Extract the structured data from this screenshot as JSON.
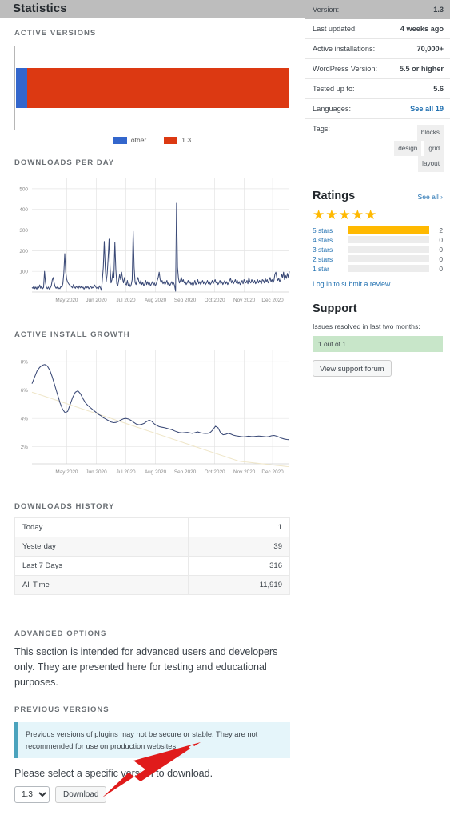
{
  "header": {
    "title": "Statistics"
  },
  "sections": {
    "active_versions": "Active Versions",
    "downloads_per_day": "Downloads Per Day",
    "active_install_growth": "Active Install Growth",
    "downloads_history": "Downloads History",
    "advanced_options": "Advanced Options",
    "previous_versions": "Previous Versions"
  },
  "meta": {
    "rows": [
      {
        "key": "Version:",
        "value": "1.3",
        "link": false
      },
      {
        "key": "Last updated:",
        "value": "4 weeks ago",
        "link": false
      },
      {
        "key": "Active installations:",
        "value": "70,000+",
        "link": false
      },
      {
        "key": "WordPress Version:",
        "value": "5.5 or higher",
        "link": false
      },
      {
        "key": "Tested up to:",
        "value": "5.6",
        "link": false
      },
      {
        "key": "Languages:",
        "value": "See all 19",
        "link": true
      }
    ],
    "tags_key": "Tags:",
    "tags": [
      "blocks",
      "design",
      "grid",
      "layout"
    ]
  },
  "ratings": {
    "title": "Ratings",
    "see_all": "See all  ›",
    "stars_filled": 5,
    "star_glyph": "★",
    "bars": [
      {
        "label": "5 stars",
        "count": 2,
        "percent": 100
      },
      {
        "label": "4 stars",
        "count": 0,
        "percent": 0
      },
      {
        "label": "3 stars",
        "count": 0,
        "percent": 0
      },
      {
        "label": "2 stars",
        "count": 0,
        "percent": 0
      },
      {
        "label": "1 star",
        "count": 0,
        "percent": 0
      }
    ],
    "review_link": "Log in to submit a review."
  },
  "support": {
    "title": "Support",
    "note": "Issues resolved in last two months:",
    "resolved": "1 out of 1",
    "button": "View support forum"
  },
  "downloads_history": {
    "rows": [
      {
        "label": "Today",
        "value": "1"
      },
      {
        "label": "Yesterday",
        "value": "39"
      },
      {
        "label": "Last 7 Days",
        "value": "316"
      },
      {
        "label": "All Time",
        "value": "11,919"
      }
    ]
  },
  "advanced": {
    "paragraph": "This section is intended for advanced users and developers only. They are presented here for testing and educational purposes.",
    "notice": "Previous versions of plugins may not be secure or stable. They are not recommended for use on production websites.",
    "select_prompt": "Please select a specific version to download.",
    "selected_version": "1.3",
    "version_options": [
      "1.3"
    ],
    "download_button": "Download"
  },
  "colors": {
    "other": "#3366cc",
    "version_1_3": "#dc3912",
    "line": "#3b4a77",
    "trend": "#efe6c8",
    "rating_bar": "#ffb900",
    "link": "#2271b1",
    "arrow": "#e01b1b"
  },
  "chart_data": [
    {
      "type": "bar",
      "name": "active_versions",
      "title": "Active Versions",
      "orientation": "horizontal",
      "stacked": true,
      "categories": [
        "other",
        "1.3"
      ],
      "values": [
        4,
        96
      ],
      "colors": [
        "#3366cc",
        "#dc3912"
      ],
      "legend": [
        "other",
        "1.3"
      ],
      "legend_position": "bottom"
    },
    {
      "type": "line",
      "name": "downloads_per_day",
      "title": "Downloads Per Day",
      "xlabel": "",
      "ylabel": "",
      "ylim": [
        0,
        550
      ],
      "yticks": [
        100,
        200,
        300,
        400,
        500
      ],
      "grid": true,
      "xticks": [
        "May 2020",
        "Jun 2020",
        "Jul 2020",
        "Aug 2020",
        "Sep 2020",
        "Oct 2020",
        "Nov 2020",
        "Dec 2020"
      ],
      "xtick_positions": [
        0.135,
        0.25,
        0.365,
        0.48,
        0.595,
        0.71,
        0.825,
        0.935
      ],
      "values": [
        22,
        18,
        30,
        16,
        24,
        14,
        26,
        20,
        34,
        18,
        28,
        16,
        22,
        100,
        46,
        22,
        16,
        24,
        14,
        20,
        30,
        58,
        70,
        44,
        26,
        18,
        24,
        14,
        20,
        16,
        28,
        22,
        40,
        90,
        186,
        96,
        62,
        48,
        40,
        34,
        30,
        26,
        20,
        36,
        24,
        18,
        28,
        22,
        16,
        30,
        20,
        26,
        18,
        24,
        14,
        22,
        30,
        20,
        26,
        16,
        22,
        28,
        18,
        24,
        20,
        34,
        26,
        18,
        22,
        16,
        30,
        20,
        8,
        60,
        120,
        245,
        120,
        50,
        86,
        160,
        256,
        120,
        44,
        60,
        100,
        70,
        240,
        110,
        40,
        30,
        56,
        86,
        60,
        96,
        64,
        44,
        70,
        40,
        34,
        56,
        30,
        40,
        26,
        36,
        60,
        294,
        120,
        46,
        36,
        56,
        70,
        50,
        40,
        56,
        36,
        46,
        30,
        40,
        56,
        36,
        50,
        36,
        44,
        30,
        40,
        50,
        34,
        44,
        30,
        40,
        56,
        70,
        96,
        60,
        44,
        56,
        40,
        50,
        36,
        44,
        56,
        36,
        46,
        30,
        40,
        50,
        36,
        44,
        30,
        4,
        430,
        120,
        66,
        44,
        56,
        70,
        50,
        60,
        44,
        50,
        36,
        44,
        56,
        40,
        50,
        36,
        44,
        30,
        40,
        56,
        36,
        44,
        60,
        40,
        50,
        36,
        46,
        56,
        40,
        50,
        36,
        44,
        56,
        40,
        50,
        36,
        44,
        56,
        40,
        50,
        60,
        44,
        50,
        36,
        44,
        56,
        40,
        50,
        36,
        46,
        56,
        40,
        50,
        36,
        44,
        56,
        66,
        44,
        56,
        40,
        50,
        60,
        44,
        56,
        40,
        50,
        36,
        44,
        56,
        40,
        60,
        50,
        44,
        56,
        40,
        70,
        50,
        44,
        60,
        50,
        44,
        56,
        40,
        50,
        60,
        44,
        56,
        50,
        40,
        60,
        56,
        44,
        66,
        50,
        60,
        44,
        56,
        70,
        50,
        60,
        44,
        56,
        86,
        96,
        70,
        56,
        66,
        50,
        60,
        86,
        70,
        96,
        60,
        80,
        66,
        90,
        70,
        100
      ]
    },
    {
      "type": "line",
      "name": "active_install_growth",
      "title": "Active Install Growth",
      "xlabel": "",
      "ylabel": "",
      "ylim": [
        0.8,
        8.8
      ],
      "yticks": [
        2,
        4,
        6,
        8
      ],
      "ytick_labels": [
        "2%",
        "4%",
        "6%",
        "8%"
      ],
      "grid": true,
      "xticks": [
        "May 2020",
        "Jun 2020",
        "Jul 2020",
        "Aug 2020",
        "Sep 2020",
        "Oct 2020",
        "Nov 2020",
        "Dec 2020"
      ],
      "xtick_positions": [
        0.135,
        0.25,
        0.365,
        0.48,
        0.595,
        0.71,
        0.825,
        0.935
      ],
      "series": [
        {
          "name": "growth",
          "values": [
            6.45,
            6.9,
            7.35,
            7.6,
            7.75,
            7.8,
            7.7,
            7.4,
            6.9,
            6.3,
            5.7,
            5.1,
            4.65,
            4.4,
            4.5,
            5.0,
            5.5,
            5.85,
            5.95,
            5.75,
            5.4,
            5.1,
            4.9,
            4.75,
            4.6,
            4.45,
            4.3,
            4.2,
            4.05,
            3.95,
            3.85,
            3.75,
            3.7,
            3.72,
            3.8,
            3.9,
            3.98,
            4.0,
            3.95,
            3.85,
            3.72,
            3.6,
            3.55,
            3.58,
            3.65,
            3.78,
            3.88,
            3.8,
            3.62,
            3.5,
            3.42,
            3.38,
            3.35,
            3.3,
            3.25,
            3.2,
            3.12,
            3.05,
            3.0,
            2.98,
            3.0,
            3.02,
            2.98,
            2.95,
            3.0,
            3.05,
            3.0,
            2.96,
            2.94,
            2.95,
            3.02,
            3.2,
            3.45,
            3.35,
            3.0,
            2.85,
            2.88,
            2.95,
            2.9,
            2.82,
            2.78,
            2.75,
            2.72,
            2.7,
            2.72,
            2.75,
            2.73,
            2.72,
            2.74,
            2.76,
            2.74,
            2.72,
            2.7,
            2.72,
            2.78,
            2.8,
            2.75,
            2.68,
            2.6,
            2.55,
            2.52,
            2.5
          ]
        },
        {
          "name": "trend",
          "values": [
            5.85,
            5.8,
            5.74,
            5.68,
            5.62,
            5.56,
            5.5,
            5.44,
            5.38,
            5.32,
            5.26,
            5.2,
            5.14,
            5.08,
            5.02,
            4.96,
            4.9,
            4.84,
            4.78,
            4.72,
            4.66,
            4.6,
            4.54,
            4.48,
            4.42,
            4.36,
            4.3,
            4.24,
            4.18,
            4.12,
            4.06,
            4.0,
            3.94,
            3.88,
            3.82,
            3.76,
            3.7,
            3.64,
            3.58,
            3.52,
            3.46,
            3.4,
            3.34,
            3.28,
            3.22,
            3.16,
            3.1,
            3.04,
            2.98,
            2.92,
            2.86,
            2.8,
            2.74,
            2.68,
            2.62,
            2.56,
            2.5,
            2.44,
            2.38,
            2.32,
            2.26,
            2.2,
            2.14,
            2.08,
            2.02,
            1.96,
            1.9,
            1.84,
            1.78,
            1.72,
            1.66,
            1.6,
            1.54,
            1.48,
            1.42,
            1.36,
            1.3,
            1.24,
            1.18,
            1.12,
            1.06,
            1.0,
            0.97,
            0.95,
            0.93,
            0.91,
            0.89,
            0.87,
            0.85,
            0.83,
            0.81,
            0.79,
            0.77,
            0.75,
            0.73,
            0.71,
            0.69,
            0.67,
            0.65,
            0.63,
            0.61,
            0.6
          ]
        }
      ]
    }
  ]
}
